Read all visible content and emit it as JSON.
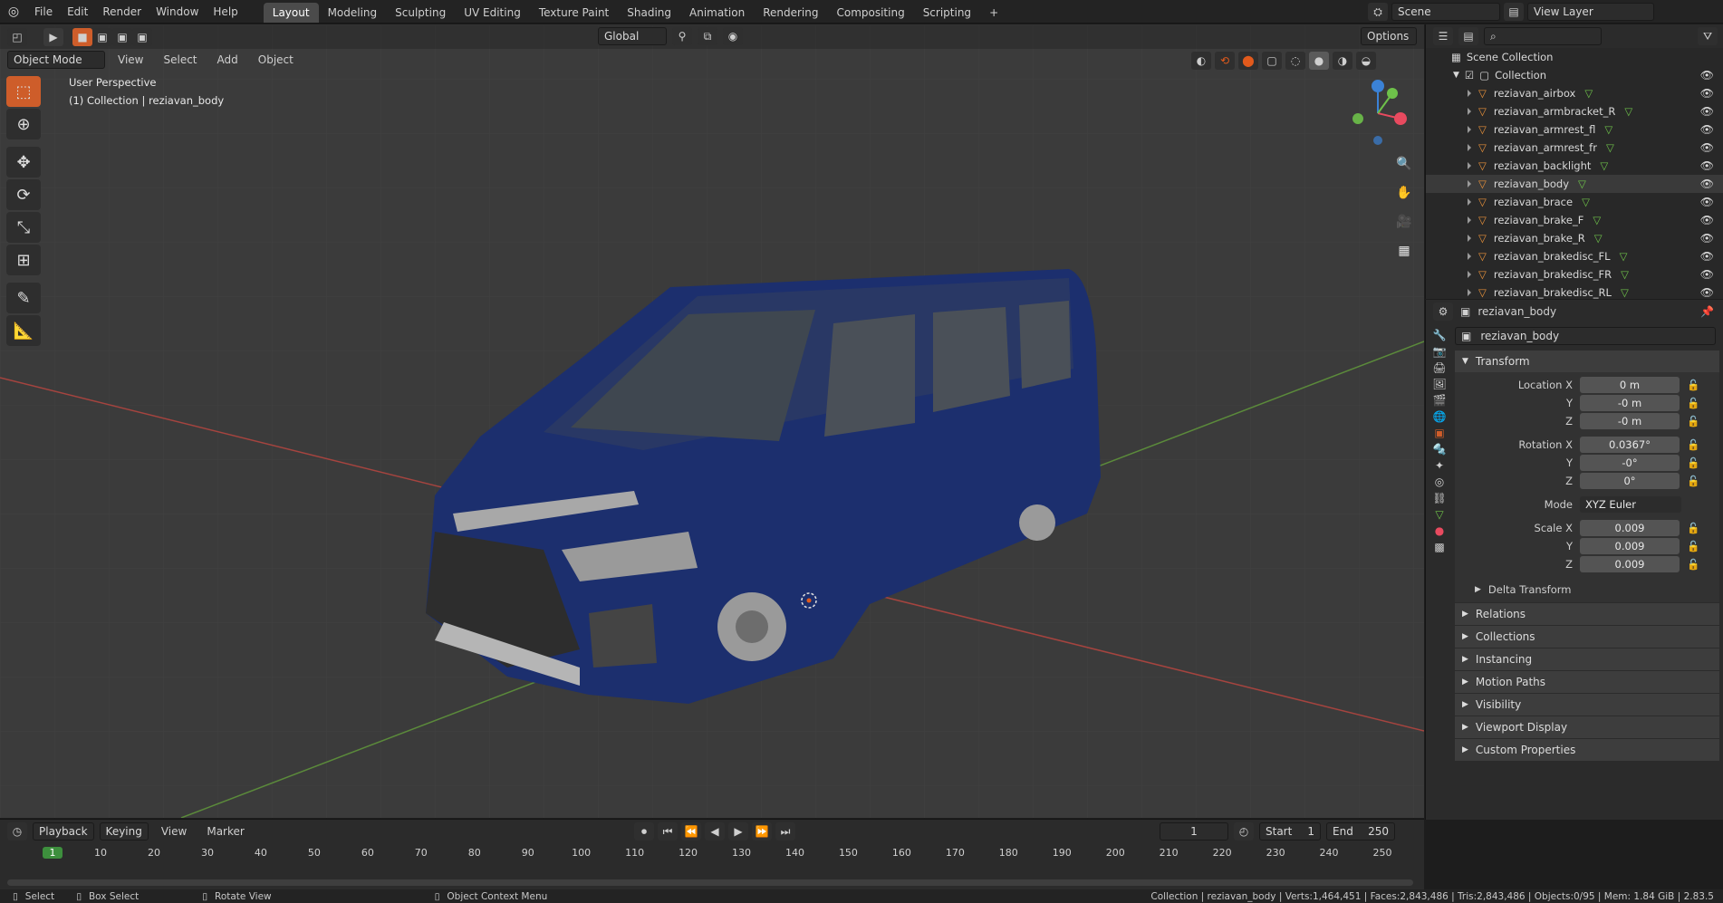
{
  "topbar": {
    "menus": [
      "File",
      "Edit",
      "Render",
      "Window",
      "Help"
    ],
    "workspaces": [
      "Layout",
      "Modeling",
      "Sculpting",
      "UV Editing",
      "Texture Paint",
      "Shading",
      "Animation",
      "Rendering",
      "Compositing",
      "Scripting"
    ],
    "active_workspace": "Layout",
    "scene": "Scene",
    "view_layer": "View Layer"
  },
  "viewport": {
    "mode": "Object Mode",
    "menus": [
      "View",
      "Select",
      "Add",
      "Object"
    ],
    "orientation": "Global",
    "options": "Options",
    "overlay_title": "User Perspective",
    "overlay_subtitle": "(1) Collection | reziavan_body"
  },
  "outliner": {
    "root": "Scene Collection",
    "collection": "Collection",
    "items": [
      "reziavan_airbox",
      "reziavan_armbracket_R",
      "reziavan_armrest_fl",
      "reziavan_armrest_fr",
      "reziavan_backlight",
      "reziavan_body",
      "reziavan_brace",
      "reziavan_brake_F",
      "reziavan_brake_R",
      "reziavan_brakedisc_FL",
      "reziavan_brakedisc_FR",
      "reziavan_brakedisc_RL"
    ],
    "selected": "reziavan_body"
  },
  "properties": {
    "object_name": "reziavan_body",
    "name_field": "reziavan_body",
    "transform_label": "Transform",
    "location_label": "Location X",
    "location": [
      "0 m",
      "-0 m",
      "-0 m"
    ],
    "rotation_label": "Rotation X",
    "rotation": [
      "0.0367°",
      "-0°",
      "0°"
    ],
    "mode_label": "Mode",
    "mode": "XYZ Euler",
    "scale_label": "Scale X",
    "scale": [
      "0.009",
      "0.009",
      "0.009"
    ],
    "axis_y": "Y",
    "axis_z": "Z",
    "delta": "Delta Transform",
    "panels": [
      "Relations",
      "Collections",
      "Instancing",
      "Motion Paths",
      "Visibility",
      "Viewport Display",
      "Custom Properties"
    ]
  },
  "timeline": {
    "menus": [
      "Playback",
      "Keying",
      "View",
      "Marker"
    ],
    "current_frame": "1",
    "start_label": "Start",
    "start": "1",
    "end_label": "End",
    "end": "250",
    "ticks": [
      "1",
      "10",
      "20",
      "30",
      "40",
      "50",
      "60",
      "70",
      "80",
      "90",
      "100",
      "110",
      "120",
      "130",
      "140",
      "150",
      "160",
      "170",
      "180",
      "190",
      "200",
      "210",
      "220",
      "230",
      "240",
      "250"
    ]
  },
  "status": {
    "select": "Select",
    "box_select": "Box Select",
    "rotate": "Rotate View",
    "context": "Object Context Menu",
    "info": "Collection | reziavan_body | Verts:1,464,451 | Faces:2,843,486 | Tris:2,843,486 | Objects:0/95 | Mem: 1.84 GiB | 2.83.5"
  },
  "colors": {
    "accent": "#ce5d2a",
    "selected_frame": "#3d8f3d",
    "x_axis": "#e84a5f",
    "y_axis": "#6ec14a",
    "z_axis": "#3b82d6",
    "car_body": "#1c2f6e"
  }
}
